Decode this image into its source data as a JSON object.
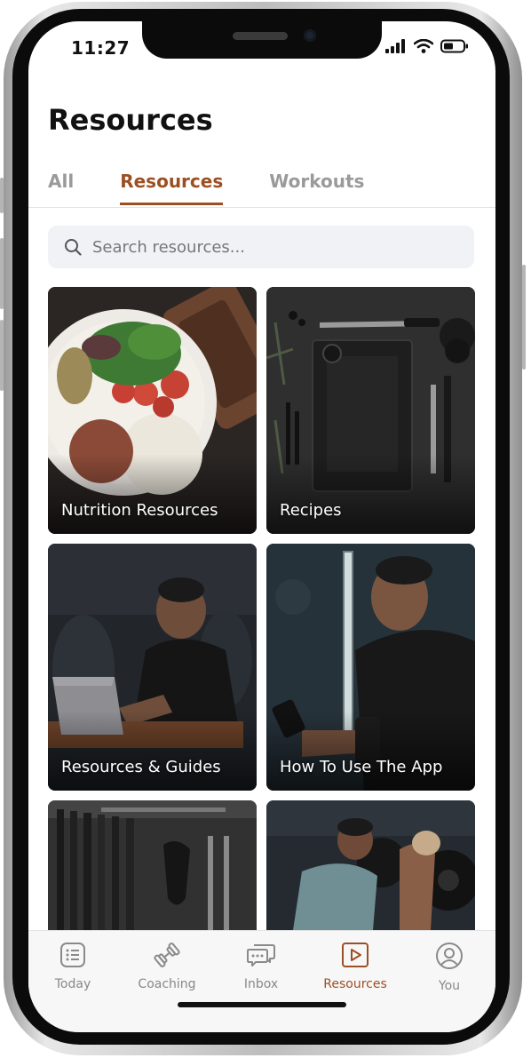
{
  "status": {
    "time": "11:27"
  },
  "page": {
    "title": "Resources"
  },
  "tabs": [
    {
      "label": "All",
      "active": false
    },
    {
      "label": "Resources",
      "active": true
    },
    {
      "label": "Workouts",
      "active": false
    }
  ],
  "search": {
    "placeholder": "Search resources..."
  },
  "cards": [
    {
      "label": "Nutrition Resources"
    },
    {
      "label": "Recipes"
    },
    {
      "label": "Resources & Guides"
    },
    {
      "label": "How To Use The App"
    },
    {
      "label": ""
    },
    {
      "label": ""
    }
  ],
  "nav": [
    {
      "label": "Today",
      "icon": "list-icon",
      "active": false
    },
    {
      "label": "Coaching",
      "icon": "dumbbell-icon",
      "active": false
    },
    {
      "label": "Inbox",
      "icon": "chat-icon",
      "active": false
    },
    {
      "label": "Resources",
      "icon": "play-icon",
      "active": true
    },
    {
      "label": "You",
      "icon": "user-icon",
      "active": false
    }
  ],
  "colors": {
    "accent": "#9c4f23",
    "inactive": "#9a9a9a"
  }
}
